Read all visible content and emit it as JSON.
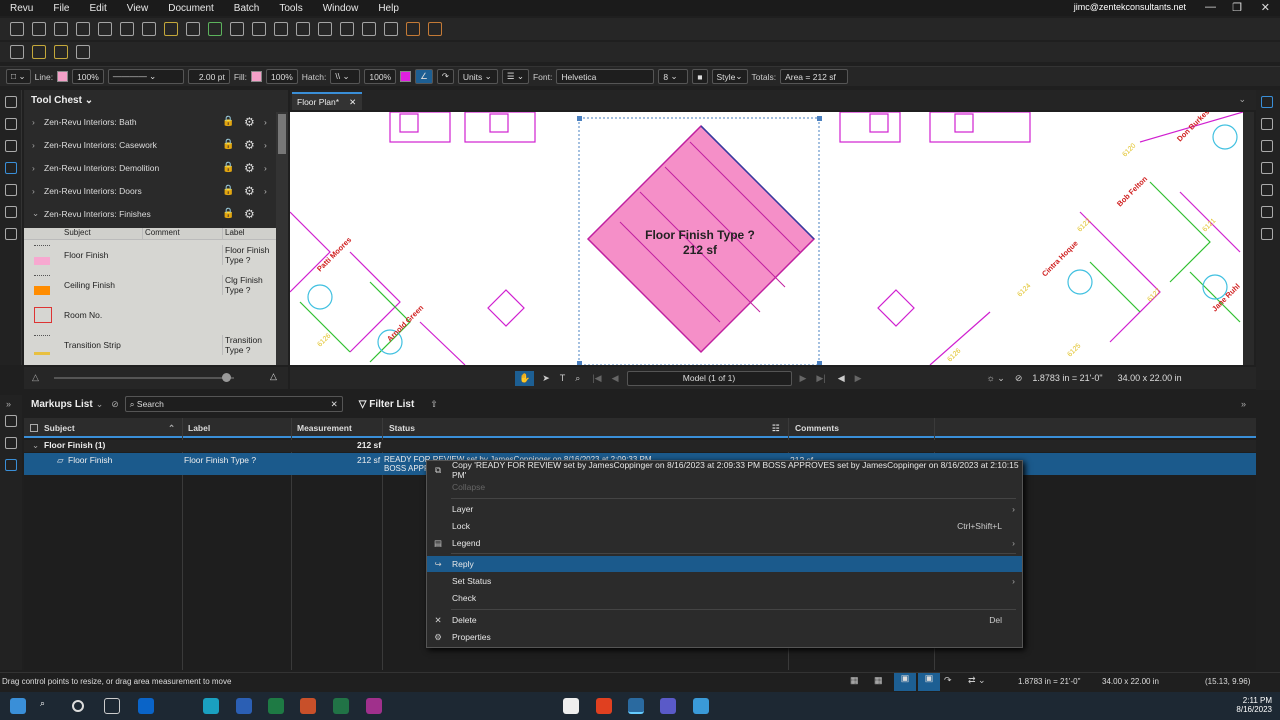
{
  "menubar": {
    "items": [
      "Revu",
      "File",
      "Edit",
      "View",
      "Document",
      "Batch",
      "Tools",
      "Window",
      "Help"
    ],
    "account": "jimc@zentekconsultants.net"
  },
  "properties": {
    "line_label": "Line:",
    "line_opacity": "100%",
    "line_width": "2.00 pt",
    "fill_label": "Fill:",
    "fill_opacity": "100%",
    "hatch_label": "Hatch:",
    "hatch_opacity": "100%",
    "units": "Units",
    "font_label": "Font:",
    "font": "Helvetica",
    "font_size": "8",
    "style": "Style",
    "totals_label": "Totals:",
    "totals": "Area = 212 sf",
    "line_color": "#f4a0c8",
    "fill_color": "#f4a0c8",
    "hatch_color": "#e020e0"
  },
  "toolchest": {
    "title": "Tool Chest",
    "items": [
      "Zen-Revu Interiors: Bath",
      "Zen-Revu Interiors: Casework",
      "Zen-Revu Interiors: Demolition",
      "Zen-Revu Interiors: Doors",
      "Zen-Revu Interiors: Finishes"
    ],
    "columns": [
      "Subject",
      "Comment",
      "Label"
    ],
    "rows": [
      {
        "subject": "Floor Finish",
        "label": "Floor Finish Type ?"
      },
      {
        "subject": "Ceiling Finish",
        "label": "Clg Finish Type ?"
      },
      {
        "subject": "Room No.",
        "label": ""
      },
      {
        "subject": "Transition Strip",
        "label": "Transition Type ?"
      }
    ]
  },
  "document": {
    "tab": "Floor Plan*",
    "markup_label_line1": "Floor Finish Type ?",
    "markup_label_line2": "212 sf",
    "names": [
      "Patti Moores",
      "Arnold Green",
      "Don Burkes",
      "Bob Felton",
      "Cintra Hoque",
      "Jane Ruhl"
    ],
    "rooms": [
      "6120",
      "6121",
      "6122",
      "6123",
      "6124",
      "6125",
      "6126",
      "6127"
    ]
  },
  "navbar": {
    "page": "Model (1 of 1)",
    "scale": "1.8783 in = 21'-0\"",
    "size": "34.00 x 22.00 in"
  },
  "markups": {
    "title": "Markups List",
    "search_placeholder": "Search",
    "filter": "Filter List",
    "columns": [
      "Subject",
      "Label",
      "Measurement",
      "Status",
      "Comments"
    ],
    "group": {
      "name": "Floor Finish (1)",
      "measurement": "212 sf"
    },
    "row": {
      "subject": "Floor Finish",
      "label": "Floor Finish Type ?",
      "measurement": "212 sf",
      "status1": "READY FOR REVIEW set by JamesCoppinger on 8/16/2023 at 2:09:33 PM",
      "status2": "BOSS APPROVES",
      "comments": "212 sf"
    }
  },
  "context_menu": {
    "copy": "Copy 'READY FOR REVIEW set by JamesCoppinger on 8/16/2023 at 2:09:33 PM BOSS APPROVES set by JamesCoppinger on 8/16/2023 at 2:10:15 PM'",
    "collapse": "Collapse",
    "layer": "Layer",
    "lock": "Lock",
    "lock_shortcut": "Ctrl+Shift+L",
    "legend": "Legend",
    "reply": "Reply",
    "set_status": "Set Status",
    "check": "Check",
    "delete": "Delete",
    "delete_shortcut": "Del",
    "properties": "Properties"
  },
  "statusbar": {
    "hint": "Drag control points to resize, or drag area measurement to move",
    "scale": "1.8783 in = 21'-0\"",
    "size": "34.00 x 22.00 in",
    "coords": "(15.13, 9.96)"
  },
  "taskbar": {
    "time": "2:11 PM",
    "date": "8/16/2023"
  }
}
